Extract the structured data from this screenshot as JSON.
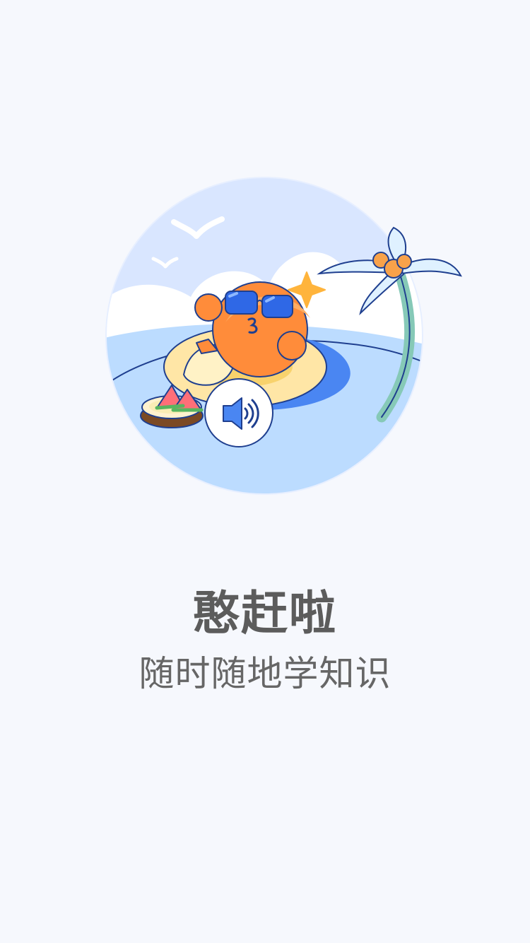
{
  "app": {
    "title": "憨赶啦",
    "slogan": "随时随地学知识"
  },
  "audio_control": {
    "icon": "speaker-icon"
  },
  "illustration": {
    "icon": "beach-mascot-illustration"
  },
  "colors": {
    "background": "#f6f8fd",
    "title": "#5c5c5c",
    "subtitle": "#666666",
    "sky": "#d9e6ff",
    "water": "#bcdcff",
    "accent_blue": "#2f68e6",
    "mascot_orange": "#ff8c3a"
  }
}
